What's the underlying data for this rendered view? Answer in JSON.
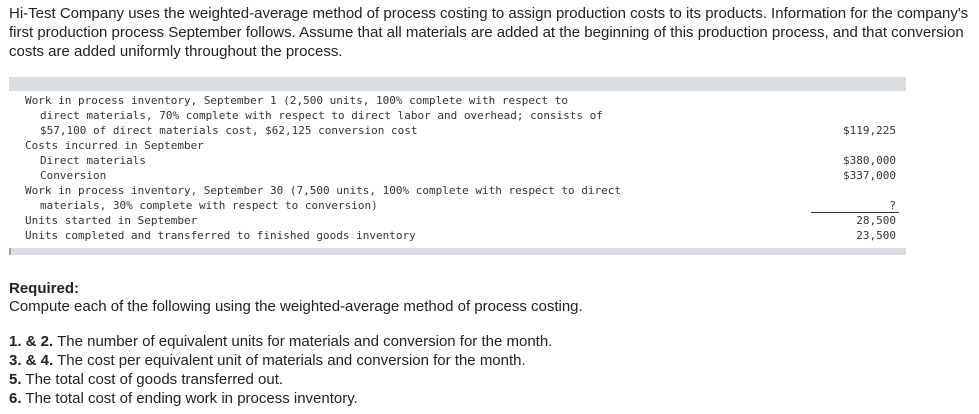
{
  "intro": "Hi-Test Company uses the weighted-average method of process costing to assign production costs to its products. Information for the company's first production process September follows. Assume that all materials are added at the beginning of this production process, and that conversion costs are added uniformly throughout the process.",
  "table": {
    "rows": [
      {
        "label": "Work in process inventory, September 1 (2,500 units, 100% complete with respect to",
        "indent": 0
      },
      {
        "label": "direct materials, 70% complete with respect to direct labor and overhead; consists of",
        "indent": 1
      },
      {
        "label": "$57,100 of direct materials cost, $62,125 conversion cost",
        "indent": 1,
        "value": "$119,225"
      },
      {
        "label": "Costs incurred in September",
        "indent": 0
      },
      {
        "label": "Direct materials",
        "indent": 1,
        "value": "$380,000"
      },
      {
        "label": "Conversion",
        "indent": 1,
        "value": "$337,000"
      },
      {
        "label": "Work in process inventory, September 30 (7,500 units, 100% complete with respect to direct",
        "indent": 0
      },
      {
        "label": "materials, 30% complete with respect to conversion)",
        "indent": 1,
        "value": "?"
      },
      {
        "label": "Units started in September",
        "indent": 0,
        "value": "28,500"
      },
      {
        "label": "Units completed and transferred to finished goods inventory",
        "indent": 0,
        "value": "23,500"
      }
    ]
  },
  "required": {
    "heading": "Required:",
    "instruction": "Compute each of the following using the weighted-average method of process costing.",
    "items": [
      {
        "num": "1. & 2.",
        "text": " The number of equivalent units for materials and conversion for the month."
      },
      {
        "num": "3. & 4.",
        "text": " The cost per equivalent unit of materials and conversion for the month."
      },
      {
        "num": "5.",
        "text": " The total cost of goods transferred out."
      },
      {
        "num": "6.",
        "text": " The total cost of ending work in process inventory."
      }
    ]
  }
}
